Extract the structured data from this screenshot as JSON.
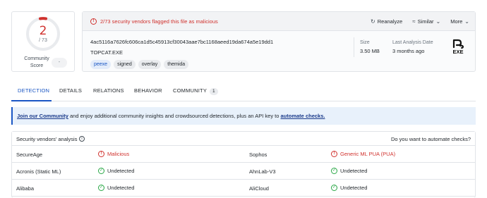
{
  "score": {
    "detections": "2",
    "total": "/ 73",
    "community_label": "Community Score",
    "community_value": "-",
    "detection_fraction": 0.027
  },
  "alert": {
    "icon": "alert-circle-icon",
    "text": "2/73 security vendors flagged this file as malicious",
    "color": "#d0312d"
  },
  "toolbar": {
    "reanalyze": "Reanalyze",
    "similar": "Similar",
    "more": "More"
  },
  "file": {
    "hash": "4ac5116a7626fc606ca1d5c45913cf30043aae7bc1168aeed19da674a5e19dd1",
    "name": "TOPCAT.EXE",
    "tags": [
      "peexe",
      "signed",
      "overlay",
      "themida"
    ],
    "size_label": "Size",
    "size_value": "3.50 MB",
    "date_label": "Last Analysis Date",
    "date_value": "3 months ago",
    "type_label": "EXE"
  },
  "tabs": [
    {
      "label": "DETECTION"
    },
    {
      "label": "DETAILS"
    },
    {
      "label": "RELATIONS"
    },
    {
      "label": "BEHAVIOR"
    },
    {
      "label": "COMMUNITY",
      "badge": "1"
    }
  ],
  "banner": {
    "link1": "Join our Community",
    "text1": " and enjoy additional community insights and crowdsourced detections, plus an API key to ",
    "link2": "automate checks."
  },
  "vendors": {
    "title": "Security vendors' analysis",
    "automate": "Do you want to automate checks?",
    "rows": [
      {
        "left_name": "SecureAge",
        "left_result": "Malicious",
        "right_name": "Sophos",
        "right_result": "Generic ML PUA (PUA)"
      },
      {
        "left_name": "Acronis (Static ML)",
        "left_result": "Undetected",
        "right_name": "AhnLab-V3",
        "right_result": "Undetected"
      },
      {
        "left_name": "Alibaba",
        "left_result": "Undetected",
        "right_name": "AliCloud",
        "right_result": "Undetected"
      }
    ]
  },
  "colors": {
    "accent": "#1a56c4",
    "malicious": "#d0312d",
    "clean": "#28a745"
  }
}
